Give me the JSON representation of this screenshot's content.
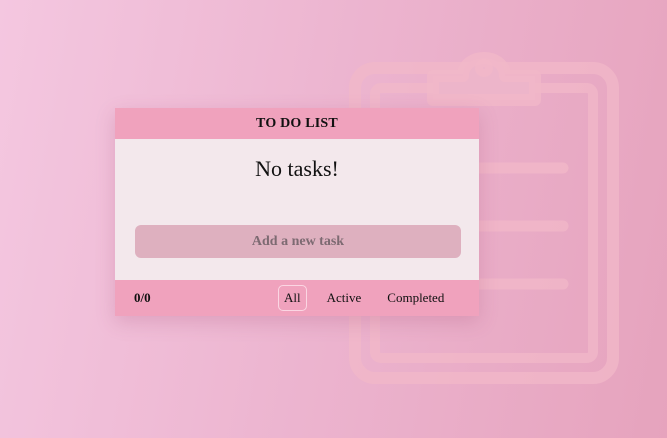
{
  "app": {
    "title": "TO DO LIST"
  },
  "tasks": {
    "empty_message": "No tasks!",
    "add_label": "Add a new task",
    "counter": "0/0"
  },
  "filters": {
    "all": "All",
    "active": "Active",
    "completed": "Completed",
    "selected": "All"
  },
  "colors": {
    "header": "#f0a2bd",
    "body": "#f3e8ec",
    "button": "#deb0bf",
    "background_start": "#f4c7e0",
    "background_end": "#e6a3bd"
  },
  "icons": {
    "background": "clipboard-icon"
  }
}
